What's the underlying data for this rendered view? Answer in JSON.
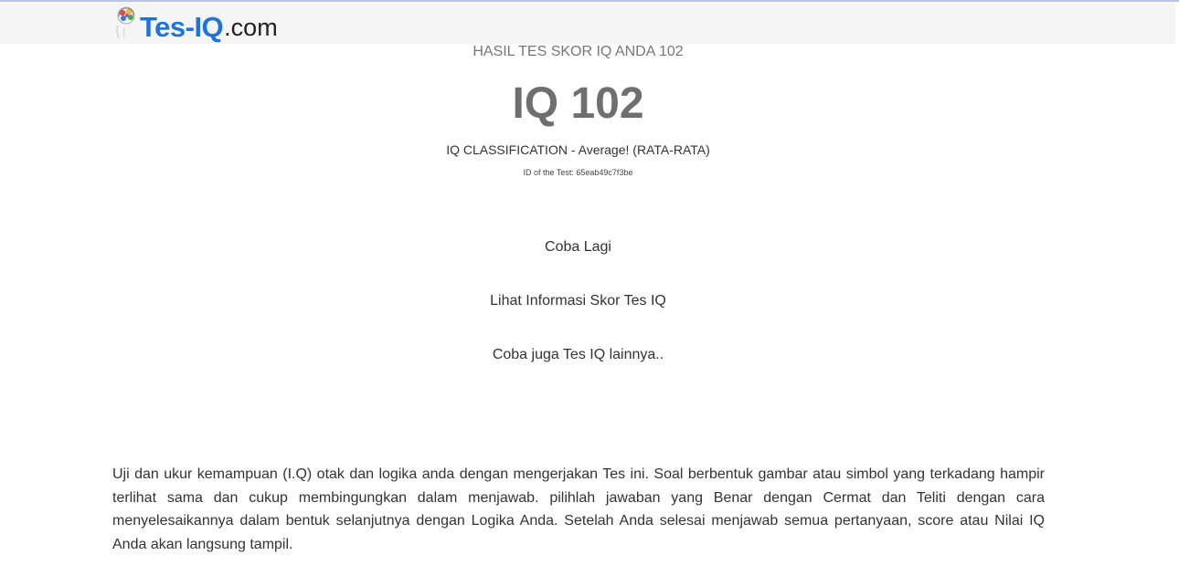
{
  "header": {
    "logo_main": "Tes-IQ",
    "logo_tld": ".com"
  },
  "result": {
    "heading": "HASIL TES SKOR IQ ANDA 102",
    "score": "IQ 102",
    "classification": "IQ CLASSIFICATION - Average! (RATA-RATA)",
    "test_id": "ID of the Test: 65eab49c7f3be"
  },
  "links": {
    "retry": "Coba Lagi",
    "info": "Lihat Informasi Skor Tes IQ",
    "other": "Coba juga Tes IQ lainnya.."
  },
  "description": "Uji dan ukur kemampuan (I.Q) otak dan logika anda dengan mengerjakan Tes ini. Soal berbentuk gambar atau simbol yang terkadang hampir terlihat sama dan cukup membingungkan dalam menjawab. pilihlah jawaban yang Benar dengan Cermat dan Teliti dengan cara menyelesaikannya dalam bentuk selanjutnya dengan Logika Anda. Setelah Anda selesai menjawab semua pertanyaan, score atau Nilai IQ Anda akan langsung tampil.",
  "colors": {
    "brand": "#1e74d8",
    "header_bg": "#f5f5f5",
    "score_text": "#6f6f6f"
  },
  "icons": {
    "logo": "brain-icon"
  }
}
